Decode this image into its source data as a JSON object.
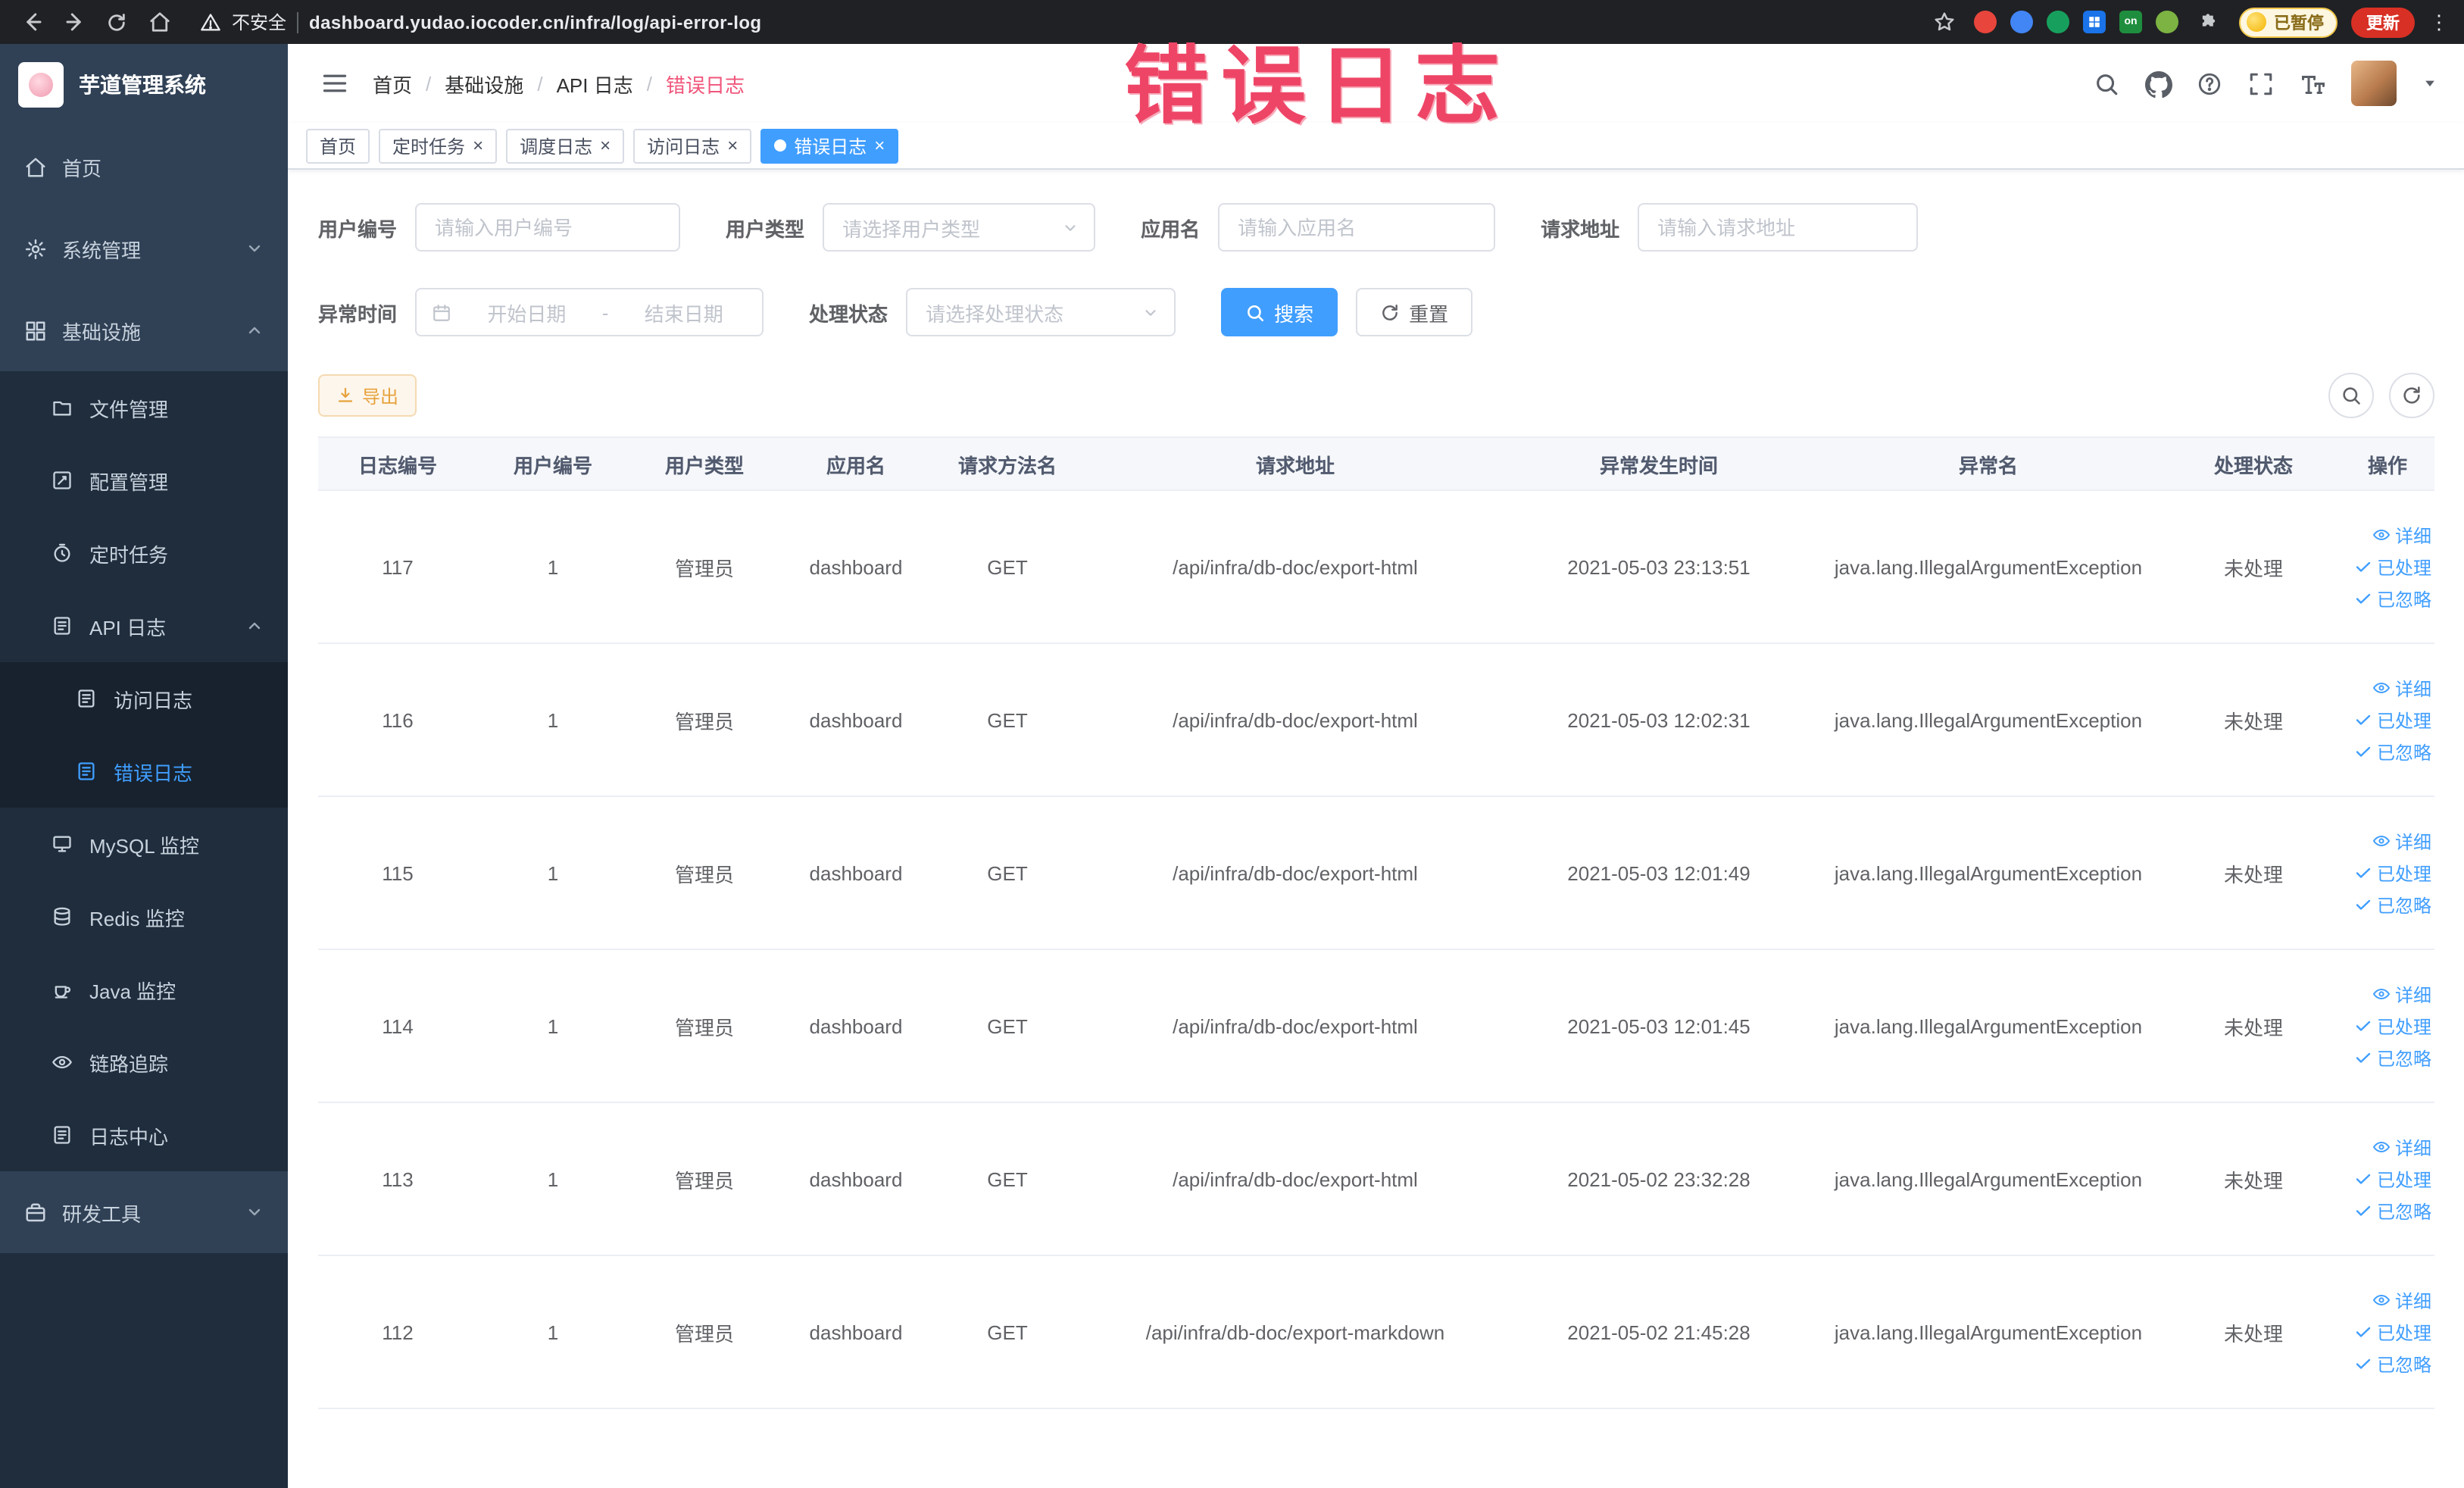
{
  "annotation": {
    "text": "错误日志"
  },
  "browser": {
    "security_label": "不安全",
    "url": "dashboard.yudao.iocoder.cn/infra/log/api-error-log",
    "ext_on_badge": "on",
    "paused_badge": "已暂停",
    "update_button": "更新"
  },
  "sidebar": {
    "logo_title": "芋道管理系统",
    "home": "首页",
    "system": "系统管理",
    "infra": "基础设施",
    "file": "文件管理",
    "config": "配置管理",
    "job": "定时任务",
    "api_log": "API 日志",
    "access_log": "访问日志",
    "error_log": "错误日志",
    "mysql": "MySQL 监控",
    "redis": "Redis 监控",
    "java": "Java 监控",
    "trace": "链路追踪",
    "log_center": "日志中心",
    "dev_tools": "研发工具"
  },
  "header": {
    "breadcrumb": [
      "首页",
      "基础设施",
      "API 日志",
      "错误日志"
    ]
  },
  "tabs": [
    {
      "label": "首页",
      "closable": false,
      "active": false
    },
    {
      "label": "定时任务",
      "closable": true,
      "active": false
    },
    {
      "label": "调度日志",
      "closable": true,
      "active": false
    },
    {
      "label": "访问日志",
      "closable": true,
      "active": false
    },
    {
      "label": "错误日志",
      "closable": true,
      "active": true
    }
  ],
  "filters": {
    "user_id": {
      "label": "用户编号",
      "placeholder": "请输入用户编号"
    },
    "user_type": {
      "label": "用户类型",
      "placeholder": "请选择用户类型"
    },
    "app_name": {
      "label": "应用名",
      "placeholder": "请输入应用名"
    },
    "request_url": {
      "label": "请求地址",
      "placeholder": "请输入请求地址"
    },
    "exception_time": {
      "label": "异常时间",
      "start_placeholder": "开始日期",
      "separator": "-",
      "end_placeholder": "结束日期"
    },
    "process_status": {
      "label": "处理状态",
      "placeholder": "请选择处理状态"
    },
    "search_button": "搜索",
    "reset_button": "重置"
  },
  "toolbar": {
    "export_label": "导出"
  },
  "table": {
    "columns": [
      "日志编号",
      "用户编号",
      "用户类型",
      "应用名",
      "请求方法名",
      "请求地址",
      "异常发生时间",
      "异常名",
      "处理状态",
      "操作"
    ],
    "actions": {
      "detail": "详细",
      "processed": "已处理",
      "ignored": "已忽略"
    },
    "rows": [
      {
        "id": "117",
        "user_id": "1",
        "user_type": "管理员",
        "app": "dashboard",
        "method": "GET",
        "url": "/api/infra/db-doc/export-html",
        "time": "2021-05-03 23:13:51",
        "exception": "java.lang.IllegalArgumentException",
        "status": "未处理"
      },
      {
        "id": "116",
        "user_id": "1",
        "user_type": "管理员",
        "app": "dashboard",
        "method": "GET",
        "url": "/api/infra/db-doc/export-html",
        "time": "2021-05-03 12:02:31",
        "exception": "java.lang.IllegalArgumentException",
        "status": "未处理"
      },
      {
        "id": "115",
        "user_id": "1",
        "user_type": "管理员",
        "app": "dashboard",
        "method": "GET",
        "url": "/api/infra/db-doc/export-html",
        "time": "2021-05-03 12:01:49",
        "exception": "java.lang.IllegalArgumentException",
        "status": "未处理"
      },
      {
        "id": "114",
        "user_id": "1",
        "user_type": "管理员",
        "app": "dashboard",
        "method": "GET",
        "url": "/api/infra/db-doc/export-html",
        "time": "2021-05-03 12:01:45",
        "exception": "java.lang.IllegalArgumentException",
        "status": "未处理"
      },
      {
        "id": "113",
        "user_id": "1",
        "user_type": "管理员",
        "app": "dashboard",
        "method": "GET",
        "url": "/api/infra/db-doc/export-html",
        "time": "2021-05-02 23:32:28",
        "exception": "java.lang.IllegalArgumentException",
        "status": "未处理"
      },
      {
        "id": "112",
        "user_id": "1",
        "user_type": "管理员",
        "app": "dashboard",
        "method": "GET",
        "url": "/api/infra/db-doc/export-markdown",
        "time": "2021-05-02 21:45:28",
        "exception": "java.lang.IllegalArgumentException",
        "status": "未处理"
      }
    ]
  },
  "colors": {
    "accent": "#409eff",
    "annotation": "#ee4566",
    "sidebar_bg": "#304156",
    "submenu_bg": "#1f2d3d",
    "warning": "#e6a23c",
    "active_tab_bg": "#409eff"
  }
}
